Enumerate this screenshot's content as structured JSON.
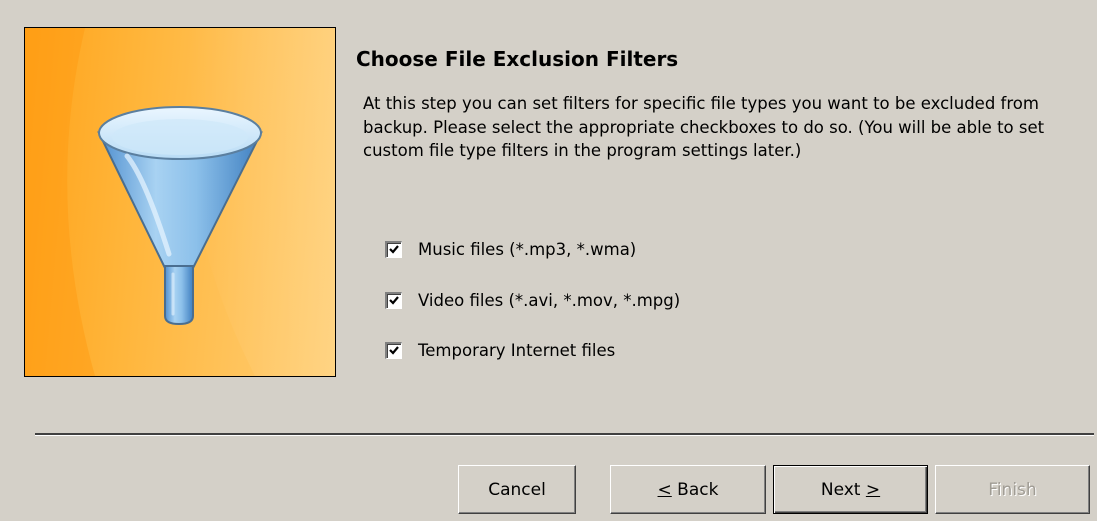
{
  "banner": {
    "icon": "funnel-icon",
    "background_colors": [
      "#ffa31a",
      "#ffce73"
    ],
    "funnel_color": "#8fc3ea"
  },
  "header": {
    "title": "Choose File Exclusion Filters",
    "description": "At this step you can set filters for specific file types you want to be excluded from backup. Please select the appropriate checkboxes to do so. (You will be able to set custom file type filters in the program settings later.)"
  },
  "filters": [
    {
      "label": "Music files (*.mp3, *.wma)",
      "checked": true
    },
    {
      "label": "Video files (*.avi, *.mov, *.mpg)",
      "checked": true
    },
    {
      "label": "Temporary Internet files",
      "checked": true
    }
  ],
  "buttons": {
    "cancel": "Cancel",
    "back_mnemonic": "<",
    "back_rest": " Back",
    "next_main": "Next ",
    "next_mnemonic": ">",
    "finish": "Finish"
  }
}
